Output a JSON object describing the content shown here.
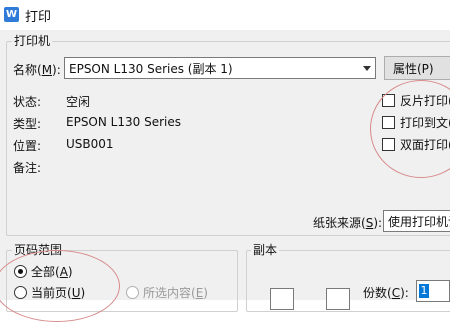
{
  "window": {
    "title": "打印",
    "icon": "wps-writer-icon",
    "icon_glyph": "W"
  },
  "printer_group": {
    "label": "打印机",
    "name_label": "名称(",
    "name_key": "M",
    "name_suffix": "):",
    "printer_selected": "EPSON L130 Series (副本 1)",
    "properties_button": "属性(P)",
    "status_label": "状态:",
    "status_value": "空闲",
    "type_label": "类型:",
    "type_value": "EPSON L130 Series",
    "location_label": "位置:",
    "location_value": "USB001",
    "comment_label": "备注:",
    "reverse_print": "反片打印(",
    "print_to_file": "打印到文(",
    "duplex_print": "双面打印(",
    "paper_source_label": "纸张来源(",
    "paper_source_key": "S",
    "paper_source_suffix": "):",
    "paper_source_value": "使用打印机设"
  },
  "range_group": {
    "label": "页码范围",
    "all_prefix": "全部(",
    "all_key": "A",
    "all_suffix": ")",
    "current_prefix": "当前页(",
    "current_key": "U",
    "current_suffix": ")",
    "selection_prefix": "所选内容(",
    "selection_key": "E",
    "selection_suffix": ")"
  },
  "copies_group": {
    "label": "副本",
    "copies_prefix": "份数(",
    "copies_key": "C",
    "copies_suffix": "):",
    "copies_value": "1"
  },
  "colors": {
    "accent": "#0078d7",
    "annotation_circle": "#d88a8a"
  }
}
